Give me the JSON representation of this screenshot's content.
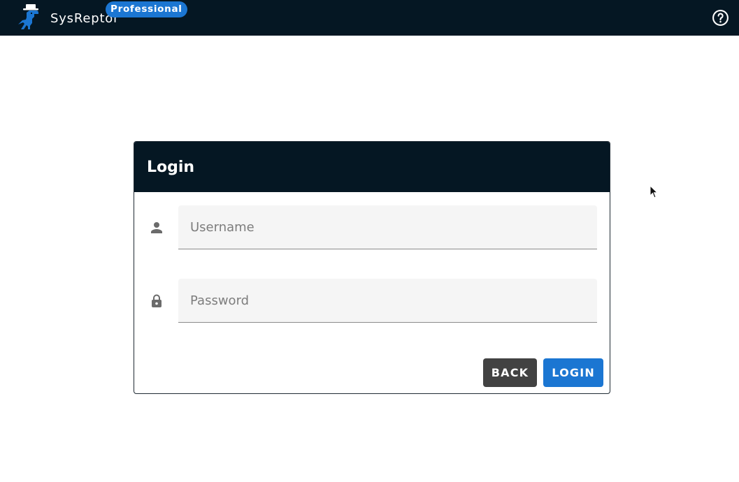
{
  "app": {
    "name": "SysReptor",
    "edition_badge": "Professional",
    "logo_icon": "dinosaur-hat-logo",
    "help_icon": "help-circle-icon"
  },
  "login": {
    "title": "Login",
    "username": {
      "icon": "account-icon",
      "placeholder": "Username",
      "value": ""
    },
    "password": {
      "icon": "lock-icon",
      "placeholder": "Password",
      "value": ""
    },
    "buttons": {
      "back": "BACK",
      "login": "LOGIN"
    }
  },
  "colors": {
    "topbar_bg": "#051723",
    "primary": "#1b76d2",
    "secondary_button": "#424242",
    "input_bg": "#f5f5f5"
  }
}
